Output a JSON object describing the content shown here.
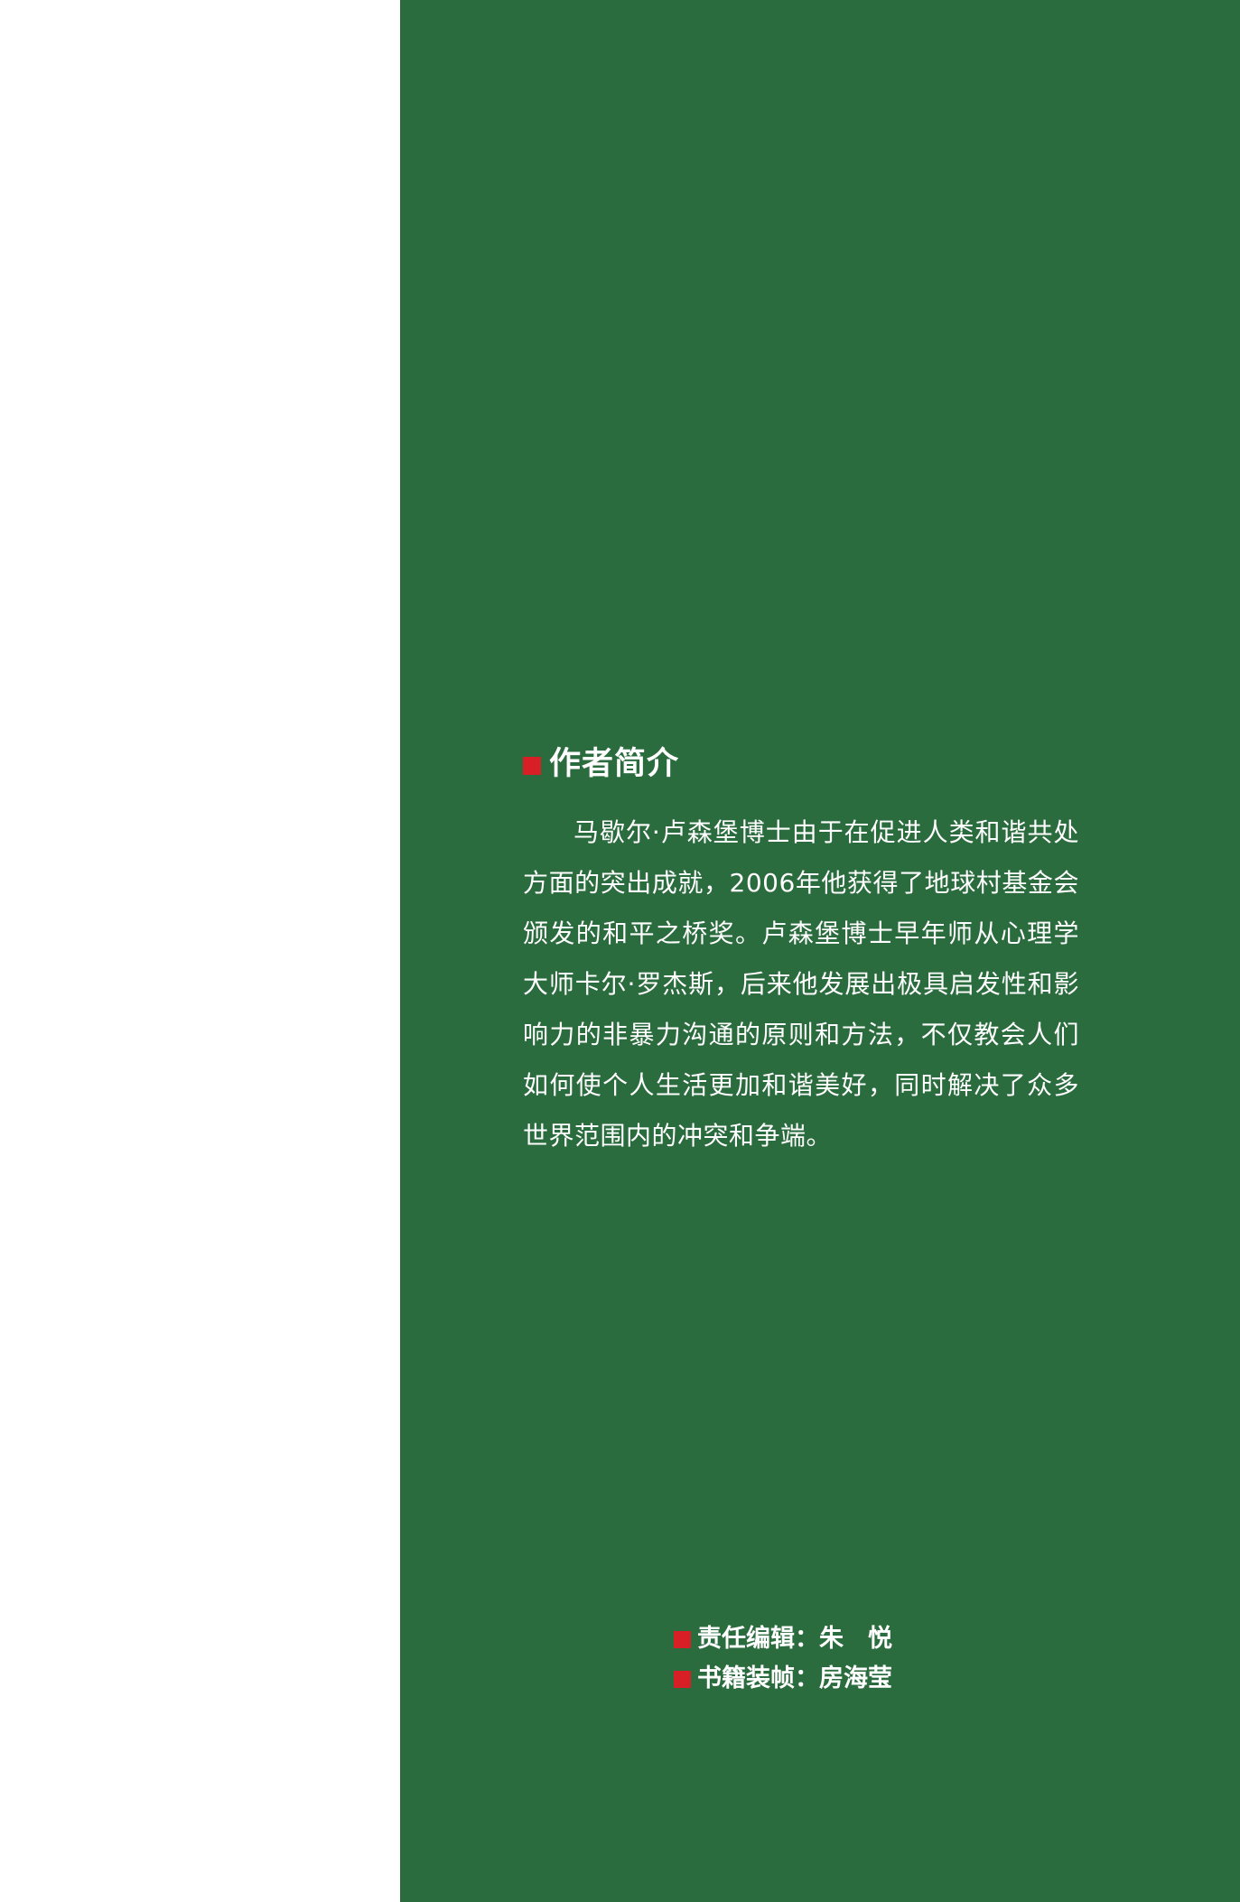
{
  "colors": {
    "panel_background": "#2b6c3e",
    "left_background": "#ffffff",
    "accent_square": "#d71f26",
    "text": "#ffffff"
  },
  "author_bio": {
    "heading": "作者简介",
    "paragraph": "马歇尔·卢森堡博士由于在促进人类和谐共处方面的突出成就，2006年他获得了地球村基金会颁发的和平之桥奖。卢森堡博士早年师从心理学大师卡尔·罗杰斯，后来他发展出极具启发性和影响力的非暴力沟通的原则和方法，不仅教会人们如何使个人生活更加和谐美好，同时解决了众多世界范围内的冲突和争端。"
  },
  "credits": [
    {
      "label": "责任编辑",
      "separator": "：",
      "value": "朱　悦"
    },
    {
      "label": "书籍装帧",
      "separator": "：",
      "value": "房海莹"
    }
  ]
}
